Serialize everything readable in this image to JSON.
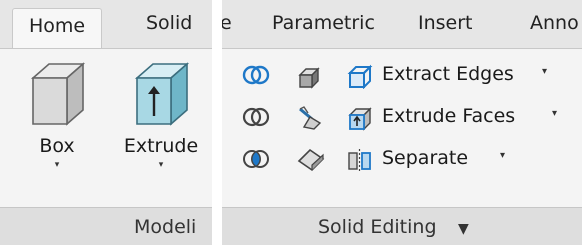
{
  "tabs": {
    "home": "Home",
    "solid": "Solid",
    "cut_fragment": "e",
    "parametric": "Parametric",
    "insert": "Insert",
    "annotate_fragment": "Anno"
  },
  "modeling": {
    "box_label": "Box",
    "box_arrow": "▾",
    "extrude_label": "Extrude",
    "extrude_arrow": "▾",
    "panel_title": "Modeli"
  },
  "solid_editing": {
    "extract_edges": "Extract Edges",
    "extrude_faces": "Extrude Faces",
    "separate": "Separate",
    "dropdown_glyph": "▾",
    "panel_title": "Solid Editing",
    "panel_arrow": "▼"
  },
  "colors": {
    "accent_blue": "#1e78c8",
    "tab_bar": "#e6e6e6",
    "panel_bg": "#f4f4f4",
    "footer_bg": "#dedede"
  }
}
